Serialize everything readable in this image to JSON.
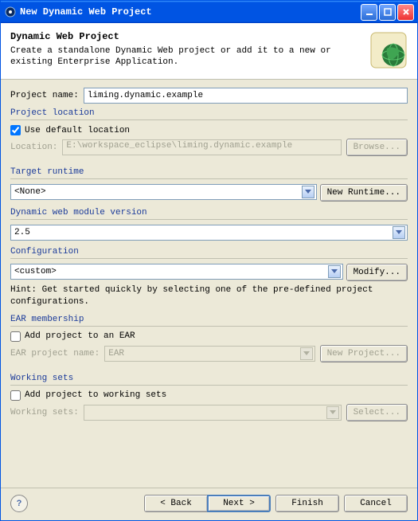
{
  "window": {
    "title": "New Dynamic Web Project"
  },
  "banner": {
    "title": "Dynamic Web Project",
    "desc": "Create a standalone Dynamic Web project or add it to a new or existing Enterprise Application."
  },
  "project_name": {
    "label": "Project name:",
    "value": "liming.dynamic.example"
  },
  "project_location": {
    "title": "Project location",
    "use_default_label": "Use default location",
    "use_default_checked": true,
    "location_label": "Location:",
    "location_value": "E:\\workspace_eclipse\\liming.dynamic.example",
    "browse_label": "Browse..."
  },
  "target_runtime": {
    "title": "Target runtime",
    "value": "<None>",
    "new_runtime_label": "New Runtime..."
  },
  "module_version": {
    "title": "Dynamic web module version",
    "value": "2.5"
  },
  "configuration": {
    "title": "Configuration",
    "value": "<custom>",
    "modify_label": "Modify...",
    "hint": "Hint: Get started quickly by selecting one of the pre-defined project configurations."
  },
  "ear": {
    "title": "EAR membership",
    "add_label": "Add project to an EAR",
    "add_checked": false,
    "project_name_label": "EAR project name:",
    "project_name_value": "EAR",
    "new_project_label": "New Project..."
  },
  "working_sets": {
    "title": "Working sets",
    "add_label": "Add project to working sets",
    "add_checked": false,
    "label": "Working sets:",
    "value": "",
    "select_label": "Select..."
  },
  "footer": {
    "back": "< Back",
    "next": "Next >",
    "finish": "Finish",
    "cancel": "Cancel"
  }
}
